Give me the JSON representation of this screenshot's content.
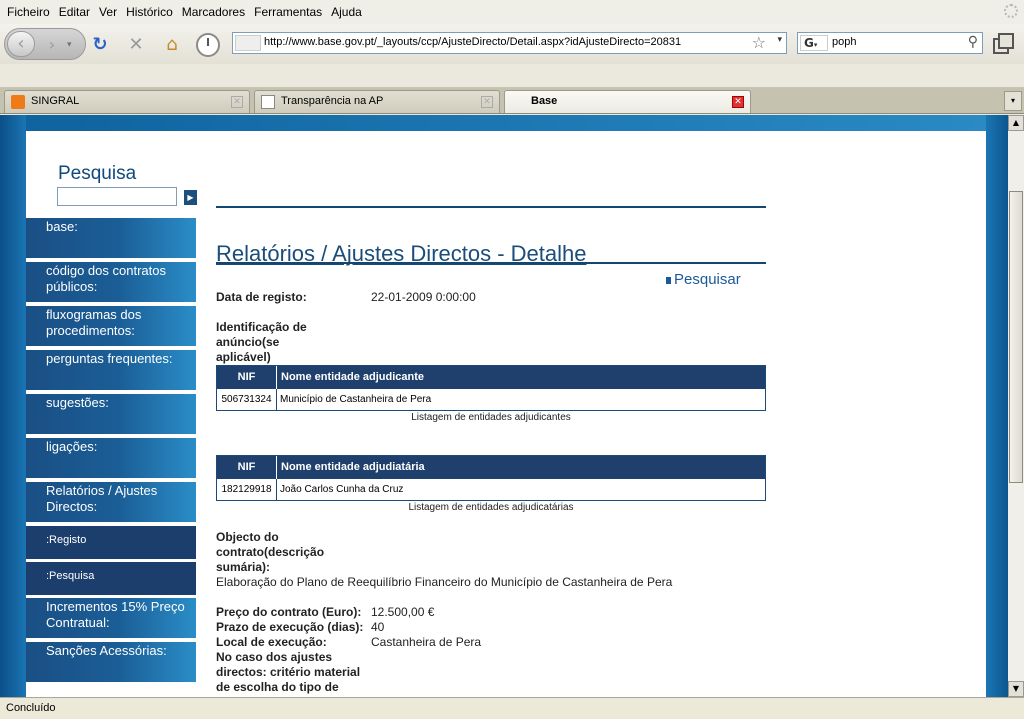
{
  "menubar": {
    "items": [
      "Ficheiro",
      "Editar",
      "Ver",
      "Histórico",
      "Marcadores",
      "Ferramentas",
      "Ajuda"
    ]
  },
  "toolbar": {
    "url": "http://www.base.gov.pt/_layouts/ccp/AjusteDirecto/Detail.aspx?idAjusteDirecto=20831",
    "search_value": "poph",
    "search_engine_letter": "G"
  },
  "tabs": [
    {
      "label": "SINGRAL"
    },
    {
      "label": "Transparência na AP"
    },
    {
      "label": "Base"
    }
  ],
  "sidebar": {
    "search_title": "Pesquisa",
    "items": [
      {
        "label": "base:"
      },
      {
        "label": "código dos contratos públicos:"
      },
      {
        "label": "fluxogramas dos procedimentos:"
      },
      {
        "label": "perguntas frequentes:"
      },
      {
        "label": "sugestões:"
      },
      {
        "label": "ligações:"
      },
      {
        "label": "Relatórios / Ajustes Directos:"
      },
      {
        "label": ":Registo"
      },
      {
        "label": ":Pesquisa"
      },
      {
        "label": "Incrementos 15% Preço Contratual:"
      },
      {
        "label": "Sanções Acessórias:"
      }
    ]
  },
  "main": {
    "heading": "Relatórios / Ajustes Directos - Detalhe",
    "search_link": "Pesquisar",
    "registration_label": "Data de registo:",
    "registration_value": "22-01-2009 0:00:00",
    "announcement_label": "Identificação de anúncio(se aplicável)",
    "contracting_table": {
      "columns": [
        "NIF",
        "Nome entidade adjudicante"
      ],
      "rows": [
        [
          "506731324",
          "Município de Castanheira de Pera"
        ]
      ],
      "caption": "Listagem de entidades adjudicantes"
    },
    "awardee_table": {
      "columns": [
        "NIF",
        "Nome entidade adjudiatária"
      ],
      "rows": [
        [
          "182129918",
          "João Carlos Cunha da Cruz"
        ]
      ],
      "caption": "Listagem de entidades adjudicatárias"
    },
    "object_label": "Objecto do contrato(descrição sumária):",
    "object_value": "Elaboração do Plano de Reequilíbrio Financeiro do Município de Castanheira de Pera",
    "price_label": "Preço do contrato (Euro):",
    "price_value": "12.500,00 €",
    "term_label": "Prazo de execução (dias):",
    "term_value": "40",
    "location_label": "Local de execução:",
    "location_value": "Castanheira de Pera",
    "criteria_label": "No caso dos ajustes directos: critério material de escolha do tipo de procedimento (se"
  },
  "status": {
    "text": "Concluído"
  }
}
